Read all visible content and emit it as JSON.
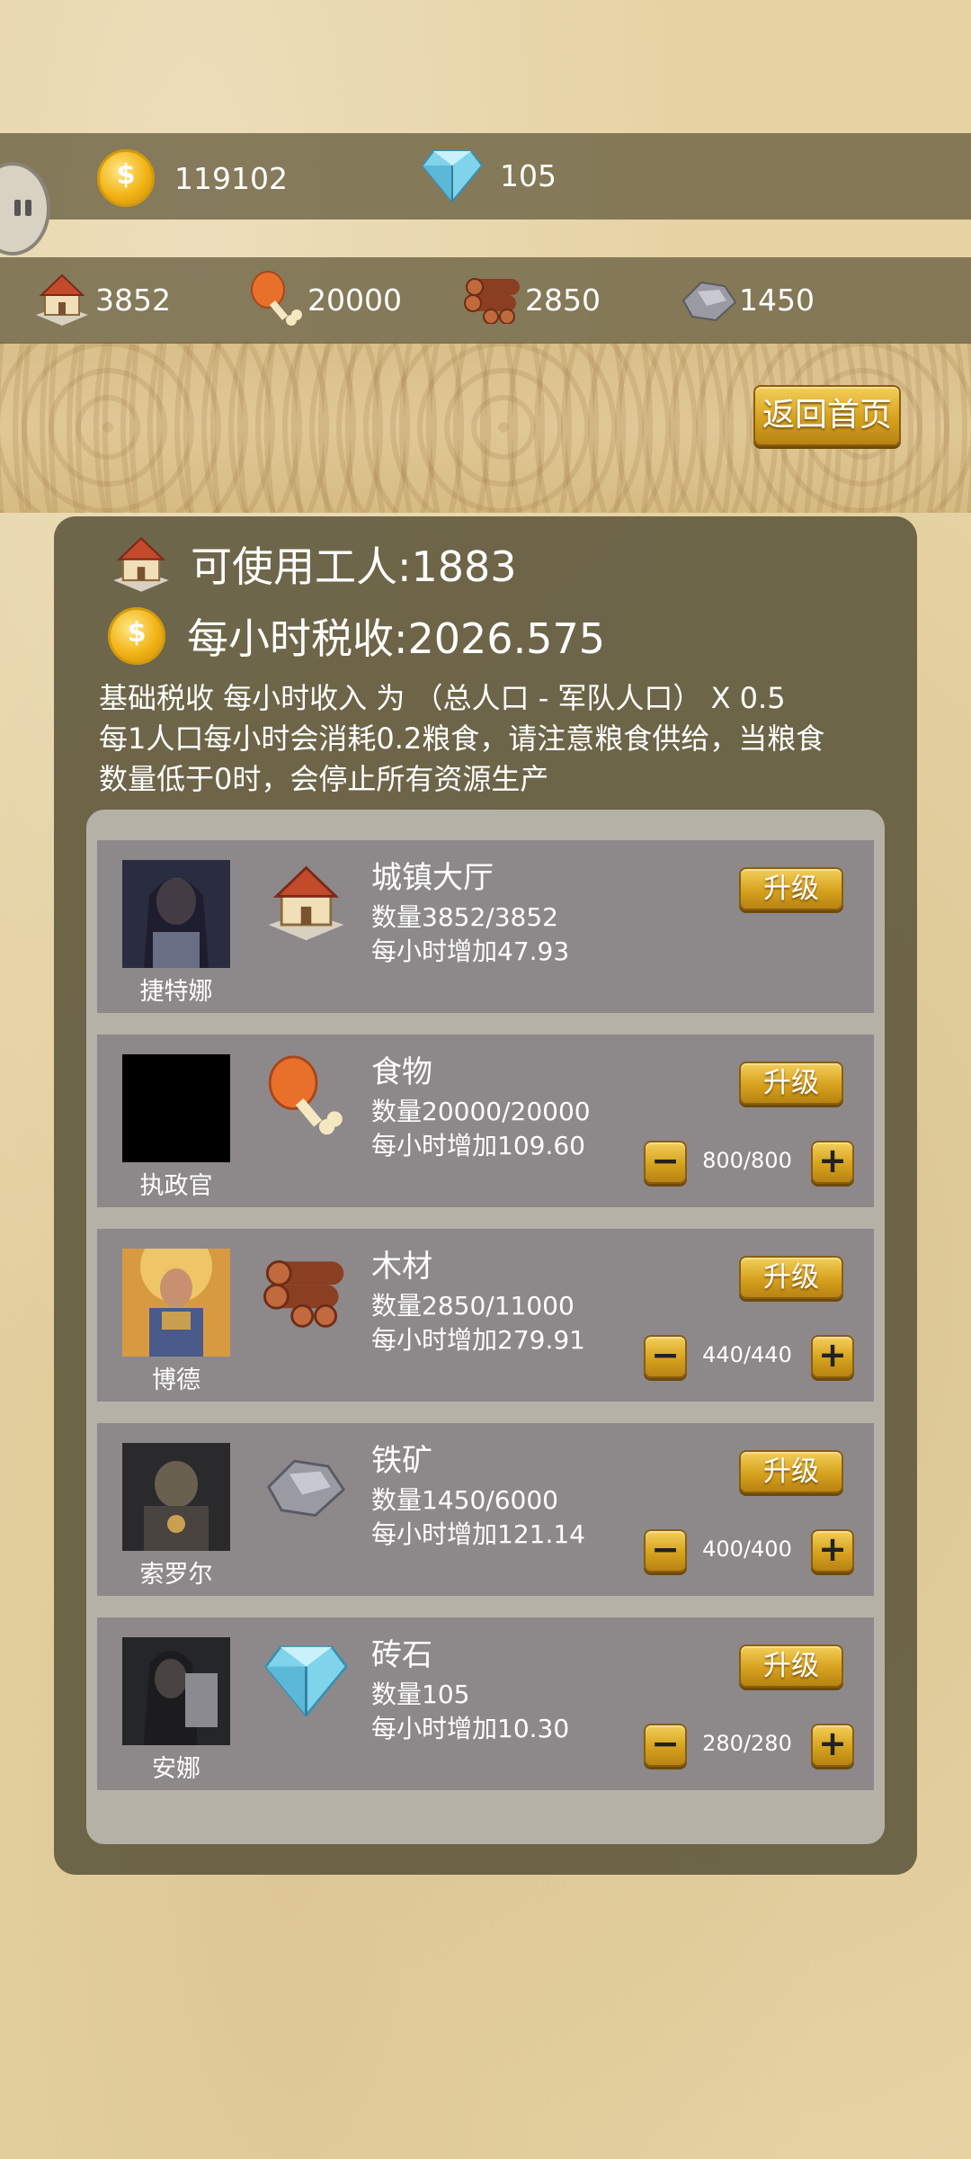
{
  "top_bar": {
    "gold": "119102",
    "diamonds": "105"
  },
  "resource_bar": {
    "population": "3852",
    "food": "20000",
    "wood": "2850",
    "iron": "1450"
  },
  "home_button_label": "返回首页",
  "panel": {
    "workers_label": "可使用工人:1883",
    "tax_label": "每小时税收:2026.575",
    "desc_line1": "基础税收 每小时收入 为 （总人口 - 军队人口） X 0.5",
    "desc_line2": "每1人口每小时会消耗0.2粮食，请注意粮食供给，当粮食",
    "desc_line3": "数量低于0时，会停止所有资源生产"
  },
  "rows": [
    {
      "hero": "捷特娜",
      "title": "城镇大厅",
      "qty": "数量3852/3852",
      "rate": "每小时增加47.93",
      "upgrade": "升级",
      "alloc": ""
    },
    {
      "hero": "执政官",
      "title": "食物",
      "qty": "数量20000/20000",
      "rate": "每小时增加109.60",
      "upgrade": "升级",
      "alloc": "800/800"
    },
    {
      "hero": "博德",
      "title": "木材",
      "qty": "数量2850/11000",
      "rate": "每小时增加279.91",
      "upgrade": "升级",
      "alloc": "440/440"
    },
    {
      "hero": "索罗尔",
      "title": "铁矿",
      "qty": "数量1450/6000",
      "rate": "每小时增加121.14",
      "upgrade": "升级",
      "alloc": "400/400"
    },
    {
      "hero": "安娜",
      "title": "砖石",
      "qty": "数量105",
      "rate": "每小时增加10.30",
      "upgrade": "升级",
      "alloc": "280/280"
    }
  ],
  "icons": {
    "gold": "coin-icon",
    "diamond": "diamond-icon",
    "population": "house-icon",
    "food": "meat-icon",
    "wood": "log-icon",
    "iron": "iron-ore-icon",
    "brick": "diamond-icon"
  }
}
